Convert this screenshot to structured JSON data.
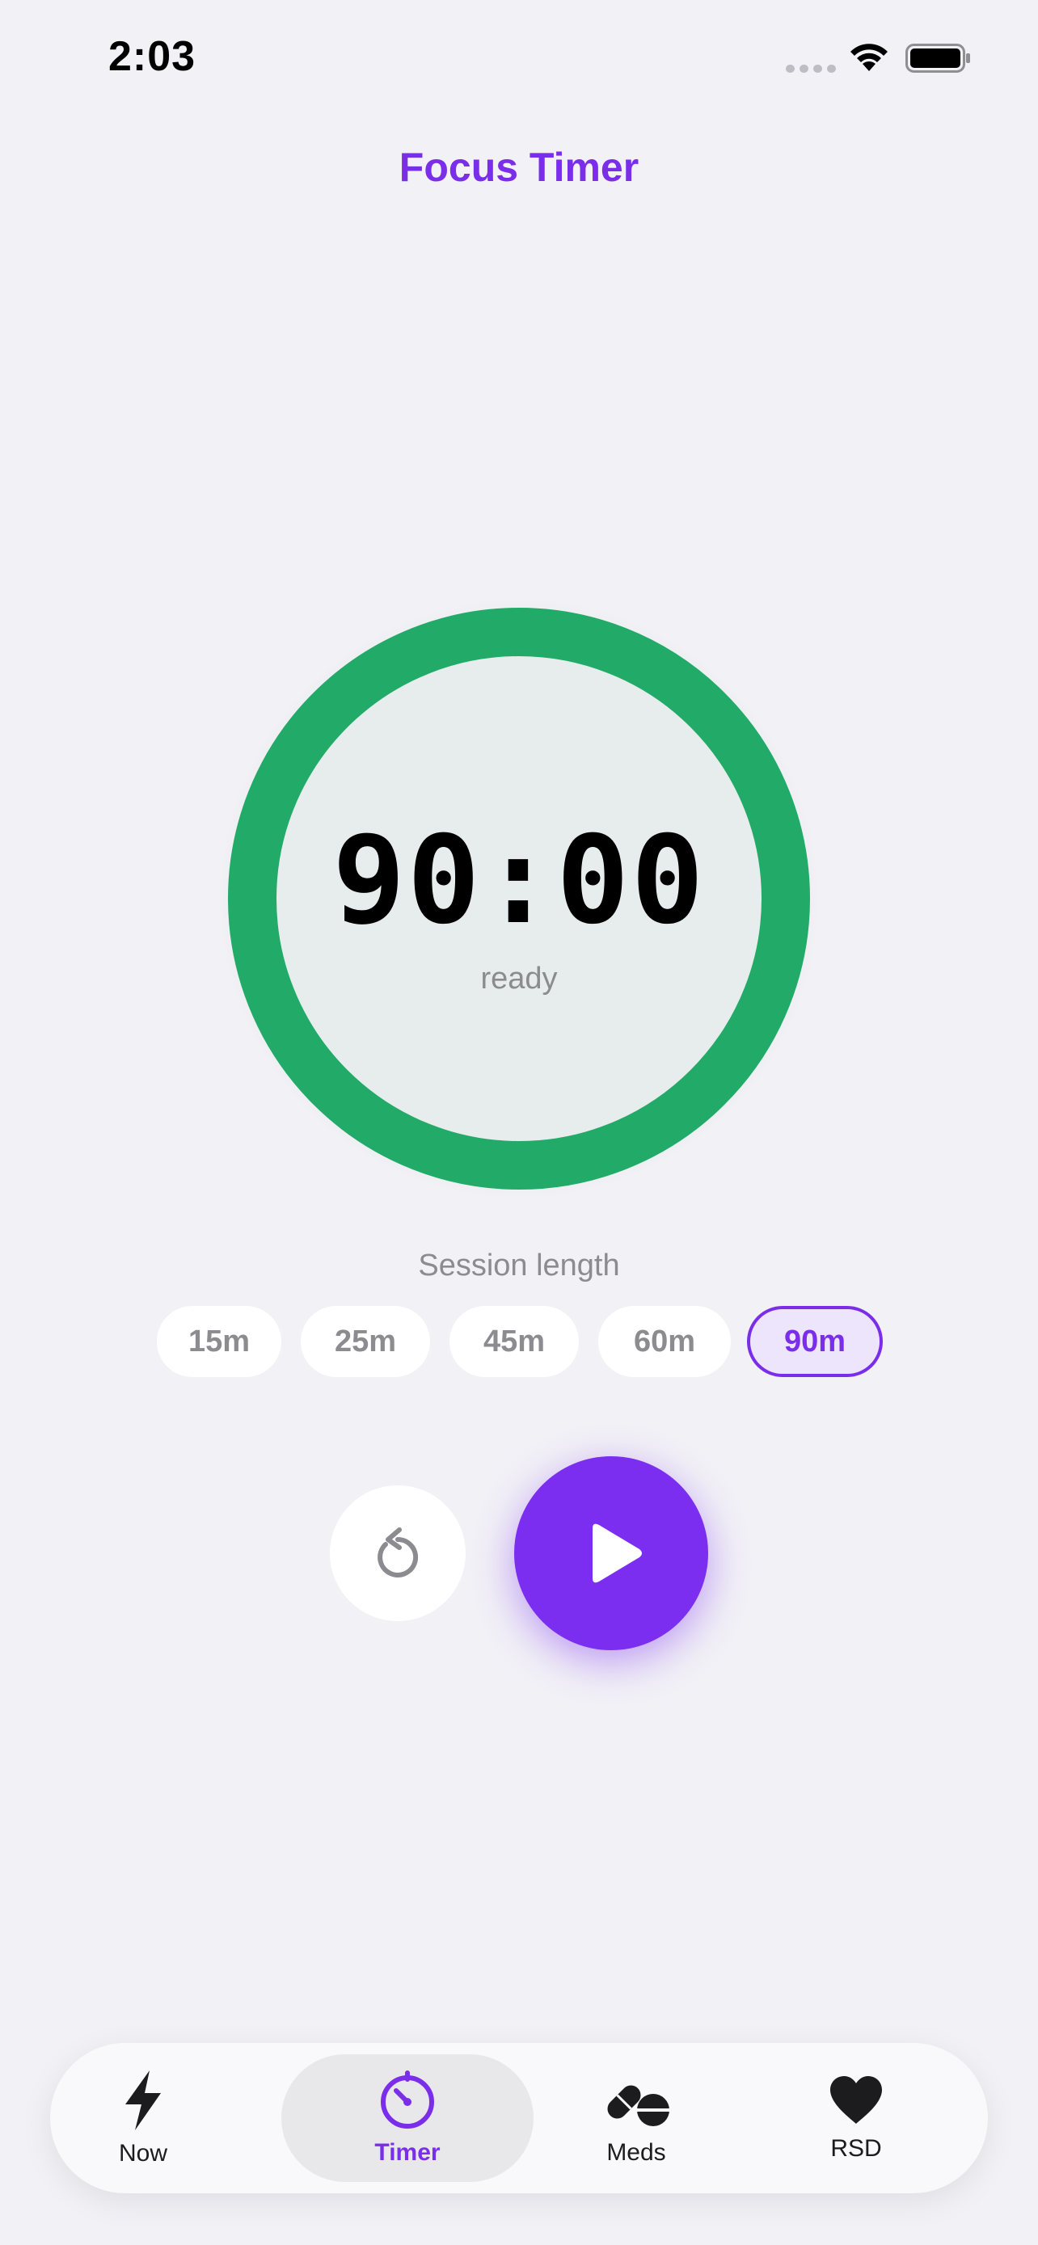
{
  "status_bar": {
    "time": "2:03"
  },
  "header": {
    "title": "Focus Timer"
  },
  "timer": {
    "value": "90:00",
    "state": "ready",
    "progress": 1.0,
    "ring_color": "#21AA68"
  },
  "session": {
    "label": "Session length",
    "options": [
      "15m",
      "25m",
      "45m",
      "60m",
      "90m"
    ],
    "selected": "90m"
  },
  "controls": {
    "reset_icon": "reset-icon",
    "play_icon": "play-icon"
  },
  "tab_bar": {
    "items": [
      {
        "label": "Now",
        "icon": "bolt-icon"
      },
      {
        "label": "Timer",
        "icon": "timer-icon"
      },
      {
        "label": "Meds",
        "icon": "pills-icon"
      },
      {
        "label": "RSD",
        "icon": "heart-icon"
      }
    ],
    "active": "Timer"
  },
  "colors": {
    "accent": "#7A2EEA",
    "ring": "#21AA68",
    "background": "#F2F1F6"
  }
}
